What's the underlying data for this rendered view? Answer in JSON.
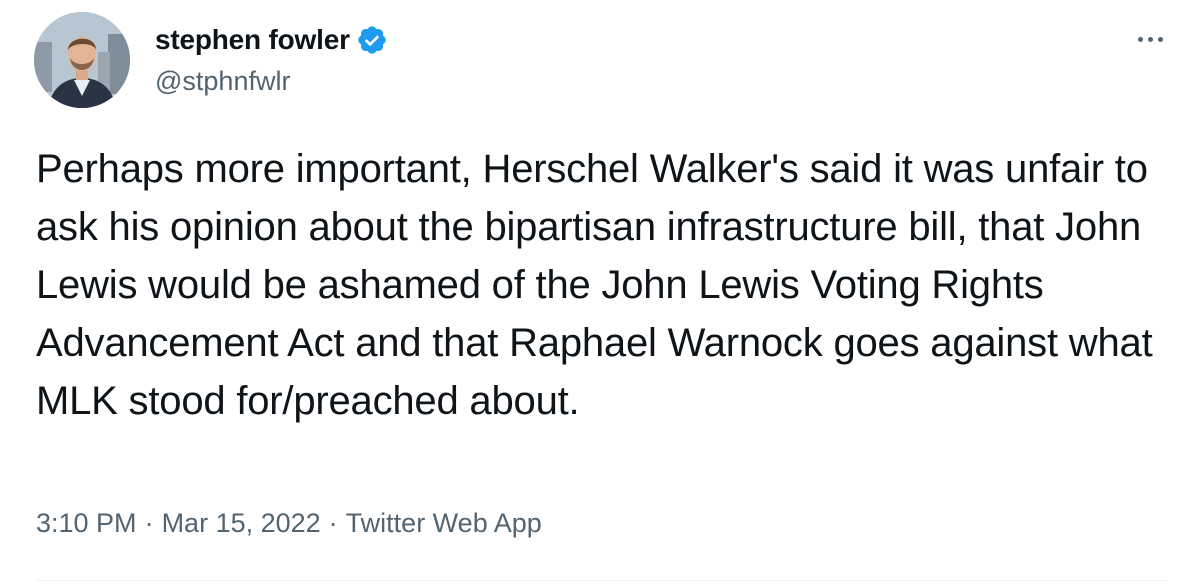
{
  "author": {
    "display_name": "stephen fowler",
    "handle": "@stphnfwlr",
    "verified": true,
    "avatar_icon": "profile-photo"
  },
  "tweet": {
    "text": "Perhaps more important, Herschel Walker's said it was unfair to ask his opinion about the bipartisan infrastructure bill, that John Lewis would be ashamed of the John Lewis Voting Rights Advancement Act and that Raphael Warnock goes against what MLK stood for/preached about.",
    "time": "3:10 PM",
    "date": "Mar 15, 2022",
    "source": "Twitter Web App",
    "separator": "·"
  },
  "colors": {
    "text_primary": "#0f1419",
    "text_secondary": "#536471",
    "verified_blue": "#1d9bf0",
    "divider": "#eff3f4"
  },
  "icons": {
    "verified": "verified-badge-icon",
    "more": "more-options-icon"
  }
}
